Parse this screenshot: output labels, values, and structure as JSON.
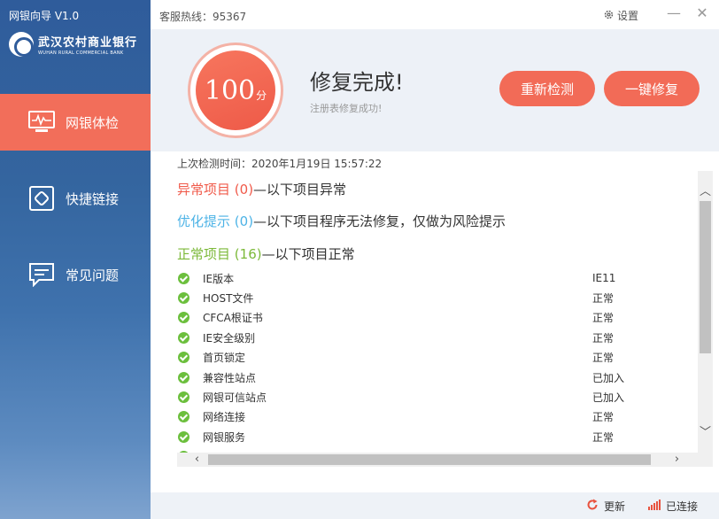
{
  "app": {
    "title": "网银向导 V1.0",
    "bank_name_cn": "武汉农村商业银行",
    "bank_name_en": "WUHAN RURAL COMMERCIAL BANK"
  },
  "sidebar": {
    "items": [
      {
        "label": "网银体检",
        "icon": "monitor-pulse-icon",
        "active": true
      },
      {
        "label": "快捷链接",
        "icon": "link-icon",
        "active": false
      },
      {
        "label": "常见问题",
        "icon": "chat-bubble-icon",
        "active": false
      }
    ]
  },
  "topbar": {
    "hotline": "客服热线：95367",
    "settings_label": "设置",
    "minimize": "—",
    "close": "✕"
  },
  "status": {
    "score": "100",
    "score_unit": "分",
    "title": "修复完成!",
    "subtitle": "注册表修复成功!",
    "recheck_label": "重新检测",
    "onekey_label": "一键修复"
  },
  "content": {
    "last_check": "上次检测时间：2020年1月19日 15:57:22",
    "sections": {
      "abnormal": {
        "label": "异常项目",
        "count": "(0)",
        "desc": "—以下项目异常"
      },
      "optimize": {
        "label": "优化提示",
        "count": "(0)",
        "desc": "—以下项目程序无法修复，仅做为风险提示"
      },
      "normal": {
        "label": "正常项目",
        "count": "(16)",
        "desc": "—以下项目正常"
      }
    },
    "rows": [
      {
        "name": "IE版本",
        "value": "IE11"
      },
      {
        "name": "HOST文件",
        "value": "正常"
      },
      {
        "name": "CFCA根证书",
        "value": "正常"
      },
      {
        "name": "IE安全级别",
        "value": "正常"
      },
      {
        "name": "首页锁定",
        "value": "正常"
      },
      {
        "name": "兼容性站点",
        "value": "已加入"
      },
      {
        "name": "网银可信站点",
        "value": "已加入"
      },
      {
        "name": "网络连接",
        "value": "正常"
      },
      {
        "name": "网银服务",
        "value": "正常"
      },
      {
        "name": "",
        "value": ""
      }
    ]
  },
  "bottombar": {
    "update_label": "更新",
    "connected_label": "已连接"
  },
  "colors": {
    "accent": "#f26b57",
    "sidebar": "#2f5c9b",
    "ok": "#7cb939",
    "info": "#4db3e6"
  }
}
